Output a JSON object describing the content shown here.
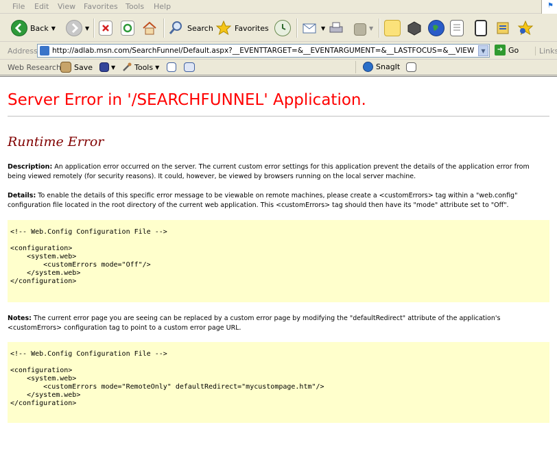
{
  "menu": [
    "File",
    "Edit",
    "View",
    "Favorites",
    "Tools",
    "Help"
  ],
  "toolbar": {
    "back_label": "Back",
    "search_label": "Search",
    "favorites_label": "Favorites"
  },
  "address": {
    "label": "Address",
    "url": "http://adlab.msn.com/SearchFunnel/Default.aspx?__EVENTTARGET=&__EVENTARGUMENT=&__LASTFOCUS=&__VIEWSTATE=%",
    "go_label": "Go",
    "links_label": "Links"
  },
  "research_bar": {
    "web_research": "Web Research",
    "save": "Save",
    "tools": "Tools",
    "snagit": "SnagIt"
  },
  "page": {
    "title": "Server Error in '/SEARCHFUNNEL' Application.",
    "subtitle": "Runtime Error",
    "description_label": "Description:",
    "description": " An application error occurred on the server. The current custom error settings for this application prevent the details of the application error from being viewed remotely (for security reasons). It could, however, be viewed by browsers running on the local server machine.",
    "details_label": "Details:",
    "details": " To enable the details of this specific error message to be viewable on remote machines, please create a <customErrors> tag within a \"web.config\" configuration file located in the root directory of the current web application. This <customErrors> tag should then have its \"mode\" attribute set to \"Off\".",
    "code1": "<!-- Web.Config Configuration File -->\n\n<configuration>\n    <system.web>\n        <customErrors mode=\"Off\"/>\n    </system.web>\n</configuration>",
    "notes_label": "Notes:",
    "notes": " The current error page you are seeing can be replaced by a custom error page by modifying the \"defaultRedirect\" attribute of the application's <customErrors> configuration tag to point to a custom error page URL.",
    "code2": "<!-- Web.Config Configuration File -->\n\n<configuration>\n    <system.web>\n        <customErrors mode=\"RemoteOnly\" defaultRedirect=\"mycustompage.htm\"/>\n    </system.web>\n</configuration>"
  },
  "colors": {
    "title": "#ff0000",
    "subtitle": "#800000",
    "code_background": "#ffffcc"
  }
}
